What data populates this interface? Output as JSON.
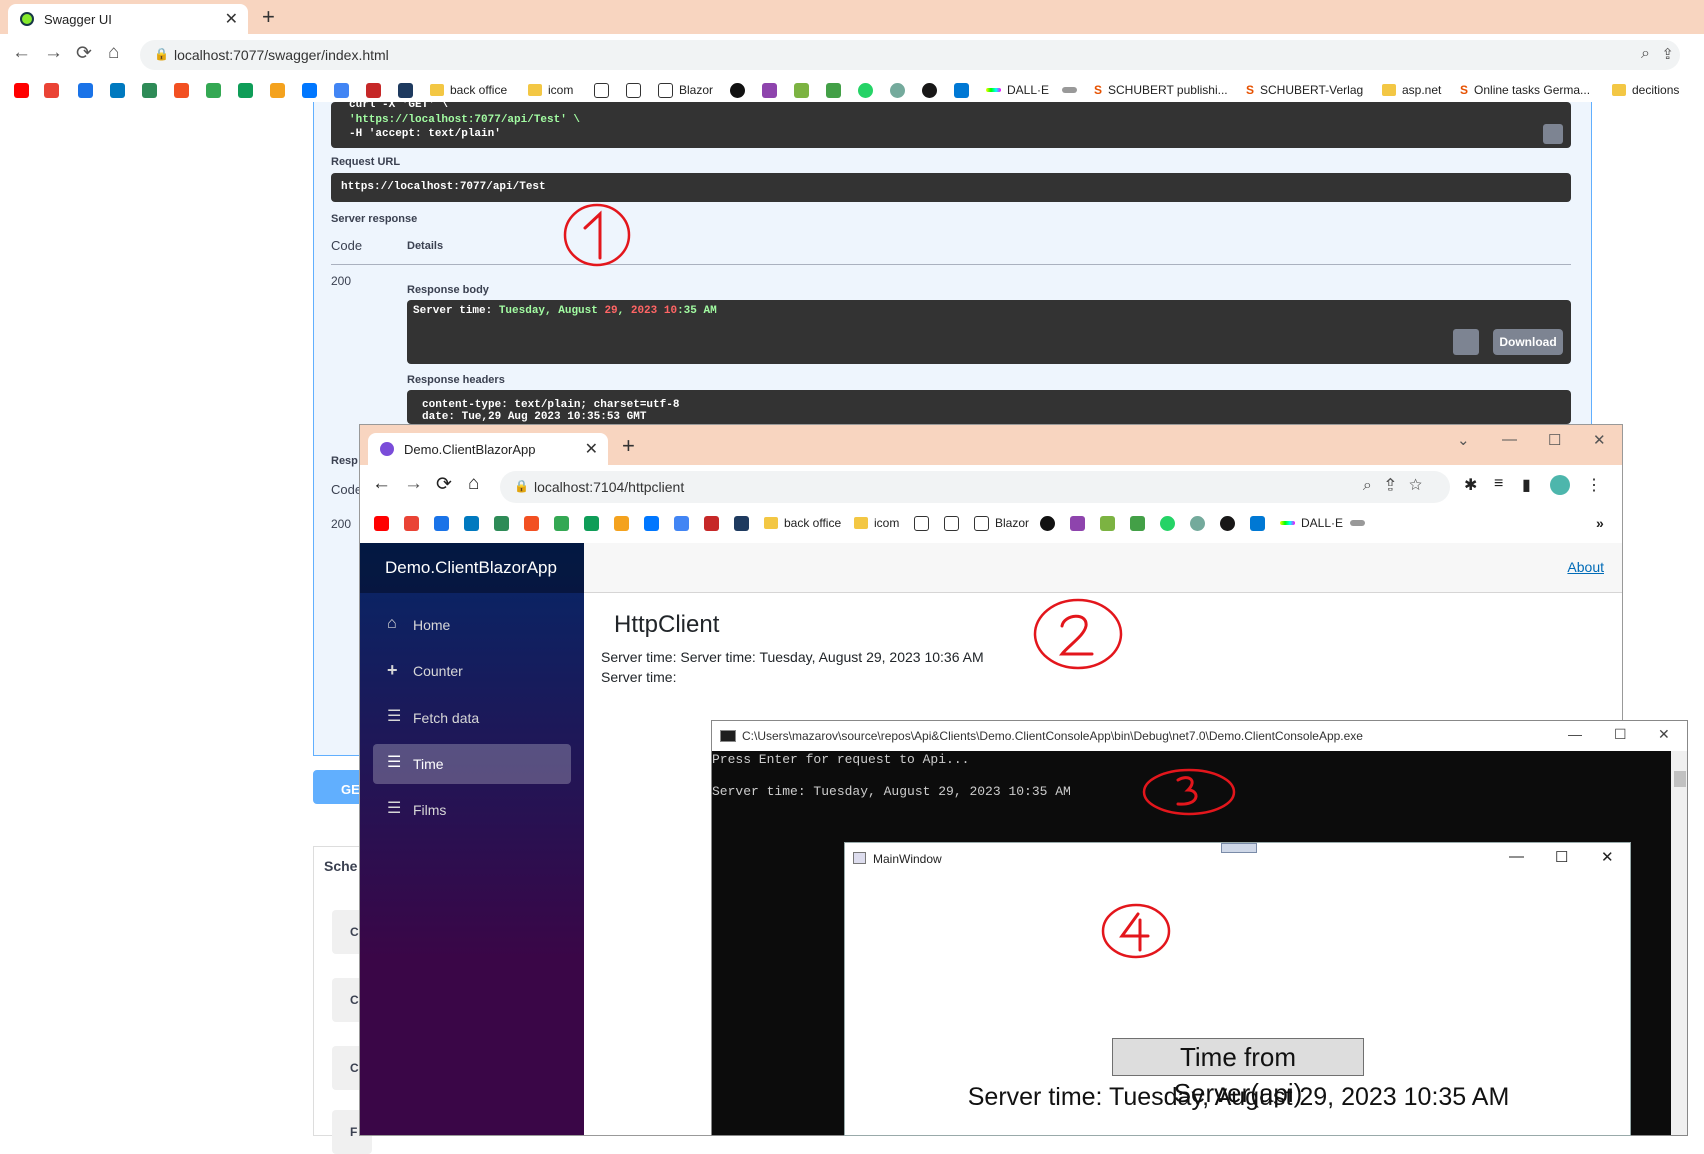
{
  "bg_browser": {
    "tab_title": "Swagger UI",
    "url": "localhost:7077/swagger/index.html",
    "bookmarks": [
      "back office",
      "icom",
      "Blazor",
      "DALL·E",
      "SCHUBERT publishi...",
      "SCHUBERT-Verlag",
      "asp.net",
      "Online tasks Germa...",
      "decitions"
    ]
  },
  "swagger": {
    "curl_line1": "curl -X 'GET' \\",
    "curl_line2": "'https://localhost:7077/api/Test' \\",
    "curl_line3": "-H 'accept: text/plain'",
    "request_url_label": "Request URL",
    "request_url": "https://localhost:7077/api/Test",
    "server_response_label": "Server response",
    "code_header": "Code",
    "details_header": "Details",
    "code": "200",
    "response_body_label": "Response body",
    "body_prefix": "Server time: ",
    "body_day": "Tuesday, August ",
    "body_num": "29",
    "body_comma": ", ",
    "body_year": "2023",
    "body_sp": " ",
    "body_hour": "10",
    "body_rest": ":35 AM",
    "download_label": "Download",
    "response_headers_label": "Response headers",
    "header_line1": "content-type: text/plain; charset=utf-8",
    "header_line2": "date: Tue,29 Aug 2023 10:35:53 GMT",
    "left_resp": "Resp",
    "left_code": "Code",
    "left_200": "200",
    "get_label": "GE",
    "schemas_label": "Sche",
    "schema_items": [
      "C",
      "C",
      "C",
      "F"
    ]
  },
  "blazor_browser": {
    "tab_title": "Demo.ClientBlazorApp",
    "url": "localhost:7104/httpclient",
    "bookmarks": [
      "back office",
      "icom",
      "Blazor",
      "DALL·E"
    ],
    "overflow": "»"
  },
  "blazor_app": {
    "brand": "Demo.ClientBlazorApp",
    "about": "About",
    "nav": [
      {
        "label": "Home",
        "icon": "home-icon"
      },
      {
        "label": "Counter",
        "icon": "plus-icon"
      },
      {
        "label": "Fetch data",
        "icon": "list-icon"
      },
      {
        "label": "Time",
        "icon": "list-icon",
        "active": true
      },
      {
        "label": "Films",
        "icon": "list-icon"
      }
    ],
    "heading": "HttpClient",
    "line1": "Server time: Server time: Tuesday, August 29, 2023 10:36 AM",
    "line2": "Server time:"
  },
  "console": {
    "title": "C:\\Users\\mazarov\\source\\repos\\Api&Clients\\Demo.ClientConsoleApp\\bin\\Debug\\net7.0\\Demo.ClientConsoleApp.exe",
    "line1": "Press Enter for request to Api...",
    "line2": "Server time: Tuesday, August 29, 2023 10:35 AM"
  },
  "wpf": {
    "title": "MainWindow",
    "button": "Time from Server(api)",
    "text": "Server time: Tuesday, August 29, 2023 10:35 AM"
  },
  "annotations": [
    "1",
    "2",
    "3",
    "4"
  ],
  "colors": {
    "tab_strip": "#f8d5c0",
    "swagger_accent": "#61affe",
    "annotation_red": "#e3161c"
  }
}
